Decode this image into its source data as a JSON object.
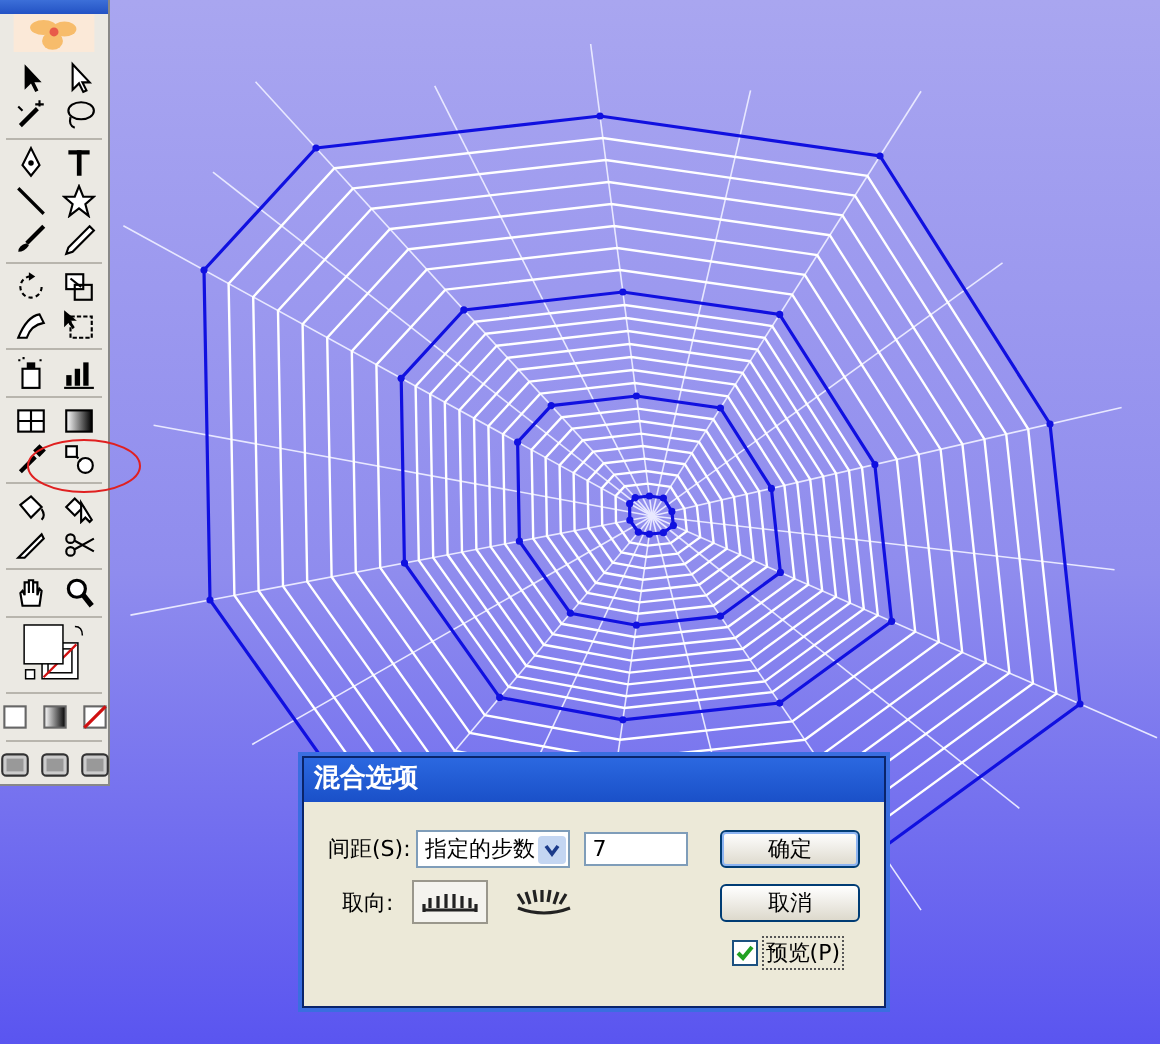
{
  "dialog": {
    "title": "混合选项",
    "spacing": {
      "label": "间距(S):",
      "value": "指定的步数",
      "steps": "7"
    },
    "orientation": {
      "label": "取向:",
      "options": [
        {
          "kind": "page",
          "selected": true
        },
        {
          "kind": "path",
          "selected": false
        }
      ]
    },
    "buttons": [
      {
        "label": "确定",
        "default": true
      },
      {
        "label": "取消",
        "default": false
      }
    ],
    "preview": {
      "label": "预览(P)",
      "checked": true
    }
  }
}
